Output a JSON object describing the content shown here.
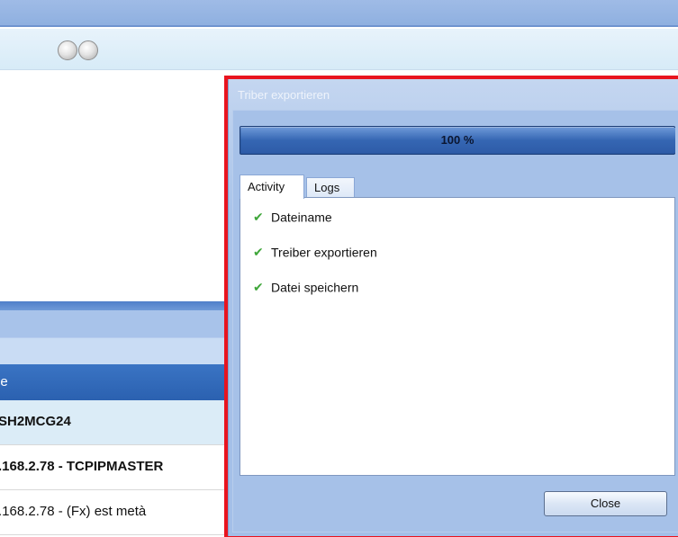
{
  "background": {
    "table": {
      "column_header": "ne",
      "rows": [
        "SH2MCG24",
        ".168.2.78 - TCPIPMASTER",
        ".168.2.78 - (Fx) est metà"
      ]
    }
  },
  "dialog": {
    "title": "Triber exportieren",
    "progress": {
      "value_percent": 100,
      "label": "100 %"
    },
    "tabs": [
      {
        "label": "Activity",
        "active": true
      },
      {
        "label": "Logs",
        "active": false
      }
    ],
    "activities": [
      {
        "label": "Dateiname",
        "icon": "check-icon",
        "status": "done"
      },
      {
        "label": "Treiber exportieren",
        "icon": "check-icon",
        "status": "done"
      },
      {
        "label": "Datei speichern",
        "icon": "check-icon",
        "status": "done"
      }
    ],
    "close_label": "Close"
  },
  "colors": {
    "highlight_border": "#e8141f",
    "check_green": "#3fa63a",
    "header_blue": "#2b61b0"
  }
}
